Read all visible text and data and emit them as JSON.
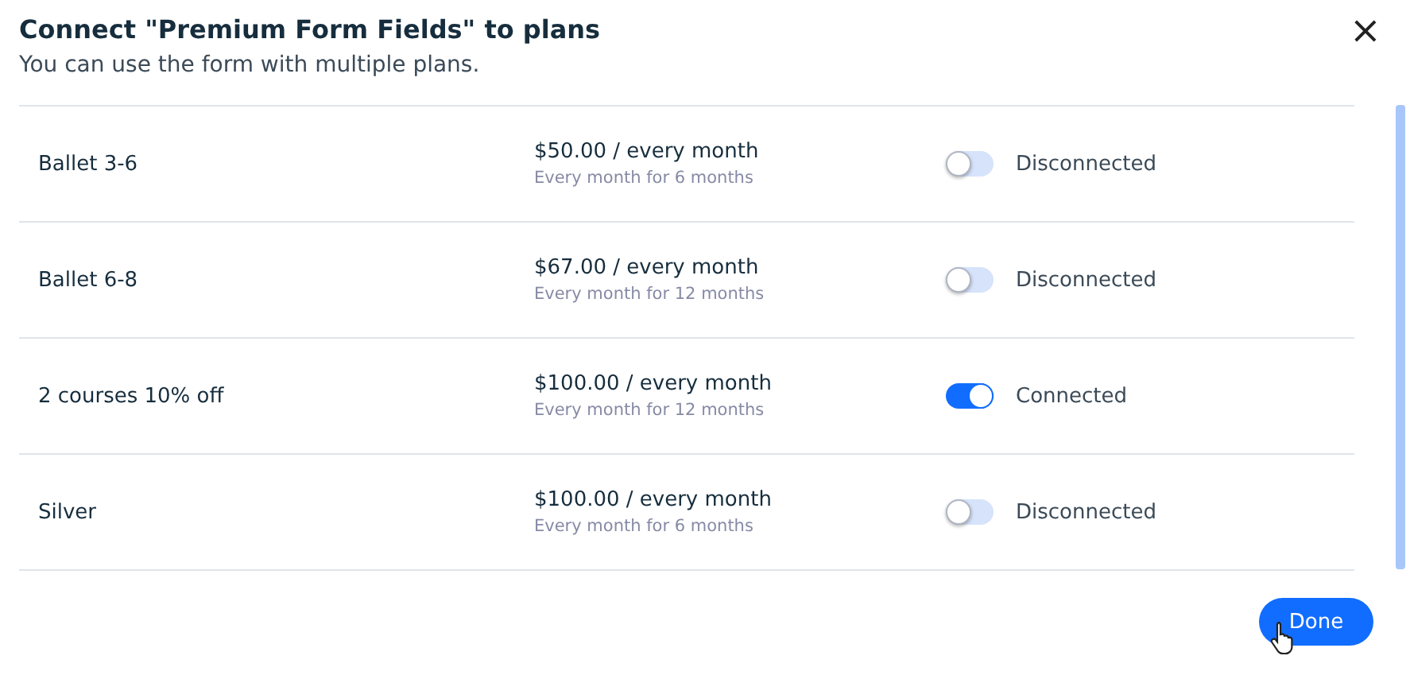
{
  "dialog": {
    "title": "Connect \"Premium Form Fields\" to plans",
    "subtitle": "You can use the form with multiple plans.",
    "close": "×"
  },
  "plans": [
    {
      "name": "Ballet 3-6",
      "price": "$50.00 / every month",
      "duration": "Every month for 6 months",
      "on": false,
      "status": "Disconnected"
    },
    {
      "name": "Ballet 6-8",
      "price": "$67.00 / every month",
      "duration": "Every month for 12 months",
      "on": false,
      "status": "Disconnected"
    },
    {
      "name": "2 courses 10% off",
      "price": "$100.00 / every month",
      "duration": "Every month for 12 months",
      "on": true,
      "status": "Connected"
    },
    {
      "name": "Silver",
      "price": "$100.00 / every month",
      "duration": "Every month for 6 months",
      "on": false,
      "status": "Disconnected"
    }
  ],
  "buttons": [
    "Done"
  ]
}
